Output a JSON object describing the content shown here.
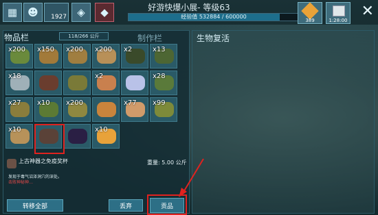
{
  "topbar": {
    "level_count": "1927",
    "title": "好游快爆小展- 等级63",
    "xp_text": "经验值 532884 / 600000",
    "xp_fraction": 0.888,
    "resource1_amount": "389",
    "resource2_amount": "1:28:00",
    "close_glyph": "✕"
  },
  "inventory": {
    "tab_label": "物品栏",
    "capacity": "118/266 公斤",
    "craft_tab_label": "制作栏",
    "slots": [
      {
        "count": "x200",
        "color": "#6a8a3c"
      },
      {
        "count": "x150",
        "color": "#a27a3a"
      },
      {
        "count": "x200",
        "color": "#a07e40"
      },
      {
        "count": "x200",
        "color": "#b89058"
      },
      {
        "count": "x2",
        "color": "#3a4a2a"
      },
      {
        "count": "x13",
        "color": "#4d6633"
      },
      {
        "count": "x18",
        "color": "#9fb0b8"
      },
      {
        "count": "",
        "color": "#6a3d2e"
      },
      {
        "count": "",
        "color": "#7a7a38"
      },
      {
        "count": "x2",
        "color": "#c9804e"
      },
      {
        "count": "",
        "color": "#b9c2e8"
      },
      {
        "count": "x28",
        "color": "#5a7a3a"
      },
      {
        "count": "x27",
        "color": "#8a7d3c"
      },
      {
        "count": "x10",
        "color": "#5c7a34"
      },
      {
        "count": "x200",
        "color": "#8f8840"
      },
      {
        "count": "",
        "color": "#c9843c"
      },
      {
        "count": "x77",
        "color": "#d19b6a"
      },
      {
        "count": "x99",
        "color": "#7d8a3a"
      },
      {
        "count": "x10",
        "color": "#b7925a"
      },
      {
        "count": "",
        "color": "#5a4238"
      },
      {
        "count": "",
        "color": "#2a1f44"
      },
      {
        "count": "x10",
        "color": "#e8a23a"
      }
    ]
  },
  "description": {
    "name": "上古神器之免疫奖杯",
    "weight": "重量: 5.00 公斤",
    "line1": "发现于毒气沼泽洞穴的深处。",
    "line2": "击败神秘神…"
  },
  "buttons": {
    "transfer_all": "转移全部",
    "drop": "丢弃",
    "tribute": "贡品"
  },
  "right_panel": {
    "title": "生物复活"
  }
}
